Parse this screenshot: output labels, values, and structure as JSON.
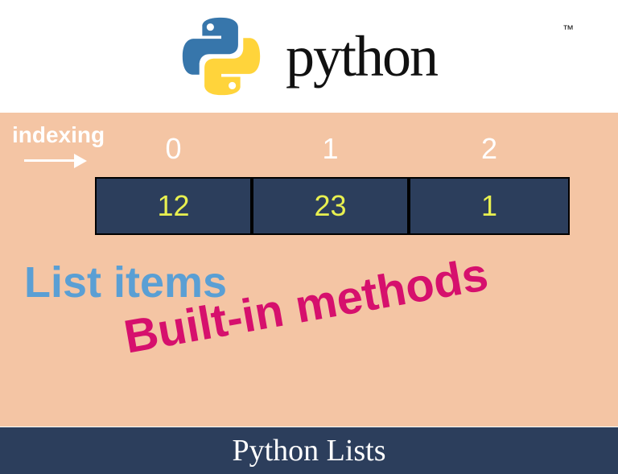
{
  "header": {
    "brand_text": "python",
    "tm": "™"
  },
  "panel": {
    "indexing_label": "indexing",
    "indices": [
      "0",
      "1",
      "2"
    ],
    "cells": [
      "12",
      "23",
      "1"
    ],
    "list_items_text": "List items",
    "builtin_text": "Built-in methods"
  },
  "footer": {
    "title": "Python Lists"
  },
  "colors": {
    "panel_bg": "#f4c5a4",
    "cell_bg": "#2c3e5c",
    "cell_text": "#e8f050",
    "list_items": "#5a9fd4",
    "builtin": "#d6106d"
  }
}
